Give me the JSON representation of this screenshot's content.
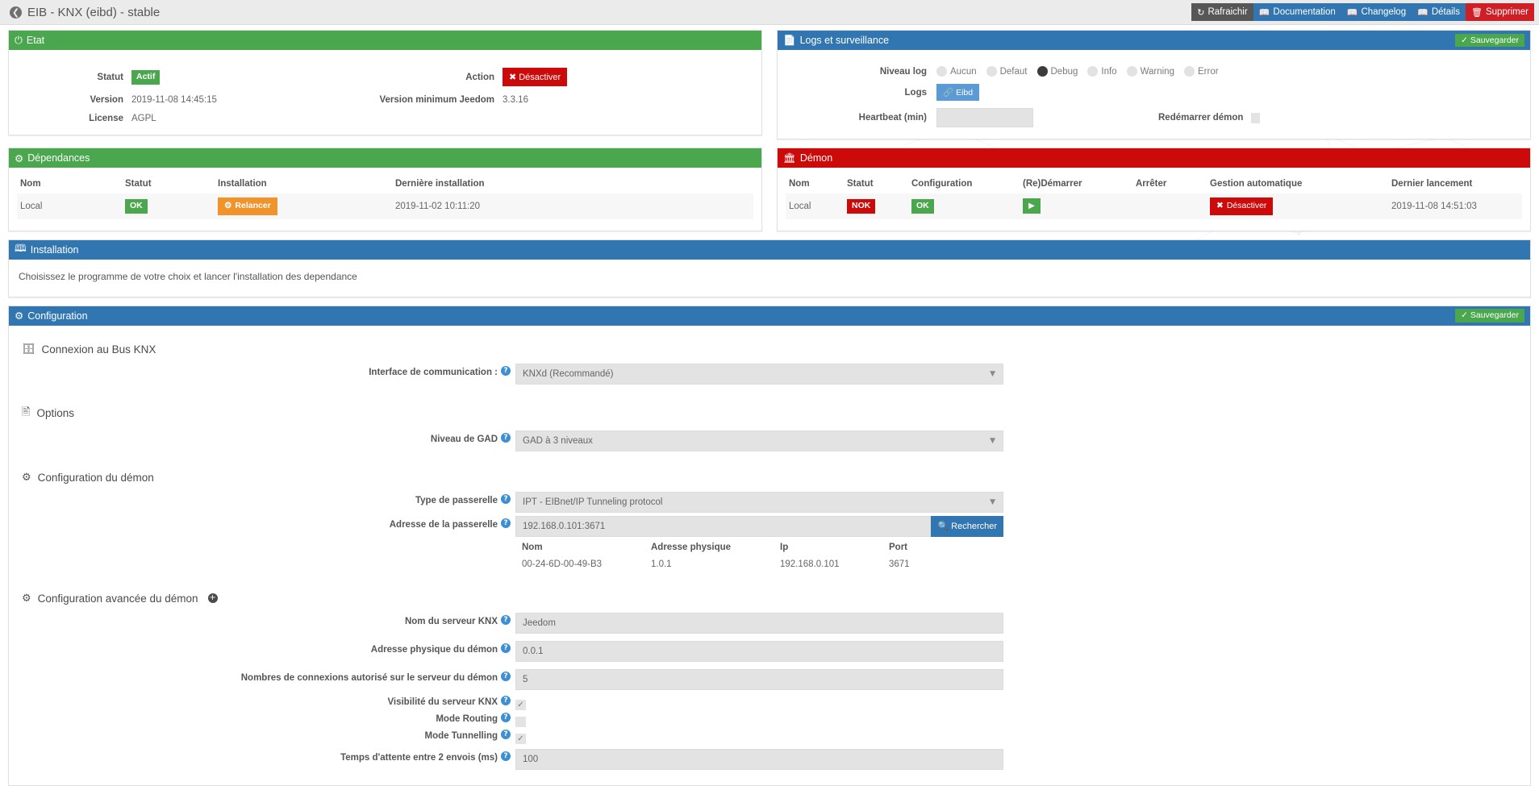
{
  "topbar": {
    "back_icon": "back-arrow-icon",
    "title": "EIB - KNX (eibd) - stable",
    "buttons": [
      {
        "label": "Rafraichir",
        "icon": "refresh-icon",
        "color": "#575757"
      },
      {
        "label": "Documentation",
        "icon": "book-icon",
        "color": "#3276b1"
      },
      {
        "label": "Changelog",
        "icon": "book-icon",
        "color": "#3276b1"
      },
      {
        "label": "Détails",
        "icon": "book-icon",
        "color": "#3276b1"
      },
      {
        "label": "Supprimer",
        "icon": "trash-icon",
        "color": "#cf1f26"
      }
    ]
  },
  "etat": {
    "title": "Etat",
    "icon": "power-icon",
    "header_color": "#4aa74e",
    "statut_label": "Statut",
    "statut_value": "Actif",
    "action_label": "Action",
    "action_button": "Désactiver",
    "version_label": "Version",
    "version_value": "2019-11-08 14:45:15",
    "version_min_label": "Version minimum Jeedom",
    "version_min_value": "3.3.16",
    "license_label": "License",
    "license_value": "AGPL"
  },
  "logs": {
    "title": "Logs et surveillance",
    "icon": "file-icon",
    "header_color": "#3276b1",
    "save_label": "Sauvegarder",
    "niveau_label": "Niveau log",
    "levels": [
      {
        "label": "Aucun",
        "selected": false
      },
      {
        "label": "Defaut",
        "selected": false
      },
      {
        "label": "Debug",
        "selected": true
      },
      {
        "label": "Info",
        "selected": false
      },
      {
        "label": "Warning",
        "selected": false
      },
      {
        "label": "Error",
        "selected": false
      }
    ],
    "logs_label": "Logs",
    "logs_button": "Eibd",
    "heartbeat_label": "Heartbeat (min)",
    "heartbeat_value": "",
    "restart_label": "Redémarrer démon",
    "restart_checked": false
  },
  "dependances": {
    "title": "Dépendances",
    "icon": "gear-icon",
    "header_color": "#4aa74e",
    "columns": [
      "Nom",
      "Statut",
      "Installation",
      "Dernière installation"
    ],
    "rows": [
      {
        "nom": "Local",
        "statut": "OK",
        "statut_color": "#4aa74e",
        "installation": "Relancer",
        "installation_color": "#f0932b",
        "derniere": "2019-11-02 10:11:20"
      }
    ]
  },
  "demon": {
    "title": "Démon",
    "icon": "bank-icon",
    "header_color": "#cd0a0a",
    "columns": [
      "Nom",
      "Statut",
      "Configuration",
      "(Re)Démarrer",
      "Arrêter",
      "Gestion automatique",
      "Dernier lancement"
    ],
    "rows": [
      {
        "nom": "Local",
        "statut": "NOK",
        "statut_color": "#cd0a0a",
        "configuration": "OK",
        "configuration_color": "#4aa74e",
        "restart_icon": "play-icon",
        "arreter": "",
        "gestion": "Désactiver",
        "gestion_color": "#cd0a0a",
        "dernier": "2019-11-08 14:51:03"
      }
    ]
  },
  "installation": {
    "title": "Installation",
    "icon": "book-open-icon",
    "header_color": "#3276b1",
    "text": "Choisissez le programme de votre choix et lancer l'installation des dependance"
  },
  "configuration": {
    "title": "Configuration",
    "icon": "sliders-icon",
    "header_color": "#3276b1",
    "save_label": "Sauvegarder",
    "sections": {
      "bus": {
        "title": "Connexion au Bus KNX",
        "icon": "server-icon"
      },
      "options": {
        "title": "Options",
        "icon": "id-card-icon"
      },
      "demon": {
        "title": "Configuration du démon",
        "icon": "gear-icon"
      },
      "avance": {
        "title": "Configuration avancée du démon",
        "icon": "gear-icon",
        "expand_icon": "plus-circle-icon"
      }
    },
    "fields": {
      "interface": {
        "label": "Interface de communication :",
        "value": "KNXd (Recommandé)",
        "type": "select"
      },
      "gad": {
        "label": "Niveau de GAD",
        "value": "GAD à 3 niveaux",
        "type": "select"
      },
      "passerelle_type": {
        "label": "Type de passerelle",
        "value": "IPT - EIBnet/IP Tunneling protocol",
        "type": "select"
      },
      "passerelle_adresse": {
        "label": "Adresse de la passerelle",
        "value": "192.168.0.101:3671",
        "type": "input",
        "button": "Rechercher",
        "button_icon": "search-icon"
      },
      "nom_serveur": {
        "label": "Nom du serveur KNX",
        "value": "Jeedom",
        "type": "input"
      },
      "adresse_physique": {
        "label": "Adresse physique du démon",
        "value": "0.0.1",
        "type": "input"
      },
      "nb_connexions": {
        "label": "Nombres de connexions autorisé sur le serveur du démon",
        "value": "5",
        "type": "input"
      },
      "visibilite": {
        "label": "Visibilité du serveur KNX",
        "checked": true,
        "type": "checkbox"
      },
      "mode_routing": {
        "label": "Mode Routing",
        "checked": false,
        "type": "checkbox"
      },
      "mode_tunnelling": {
        "label": "Mode Tunnelling",
        "checked": true,
        "type": "checkbox"
      },
      "temps_attente": {
        "label": "Temps d'attente entre 2 envois (ms)",
        "value": "100",
        "type": "input"
      }
    },
    "gateway_table": {
      "columns": [
        "Nom",
        "Adresse physique",
        "Ip",
        "Port"
      ],
      "rows": [
        {
          "nom": "00-24-6D-00-49-B3",
          "adresse": "1.0.1",
          "ip": "192.168.0.101",
          "port": "3671"
        }
      ]
    }
  }
}
